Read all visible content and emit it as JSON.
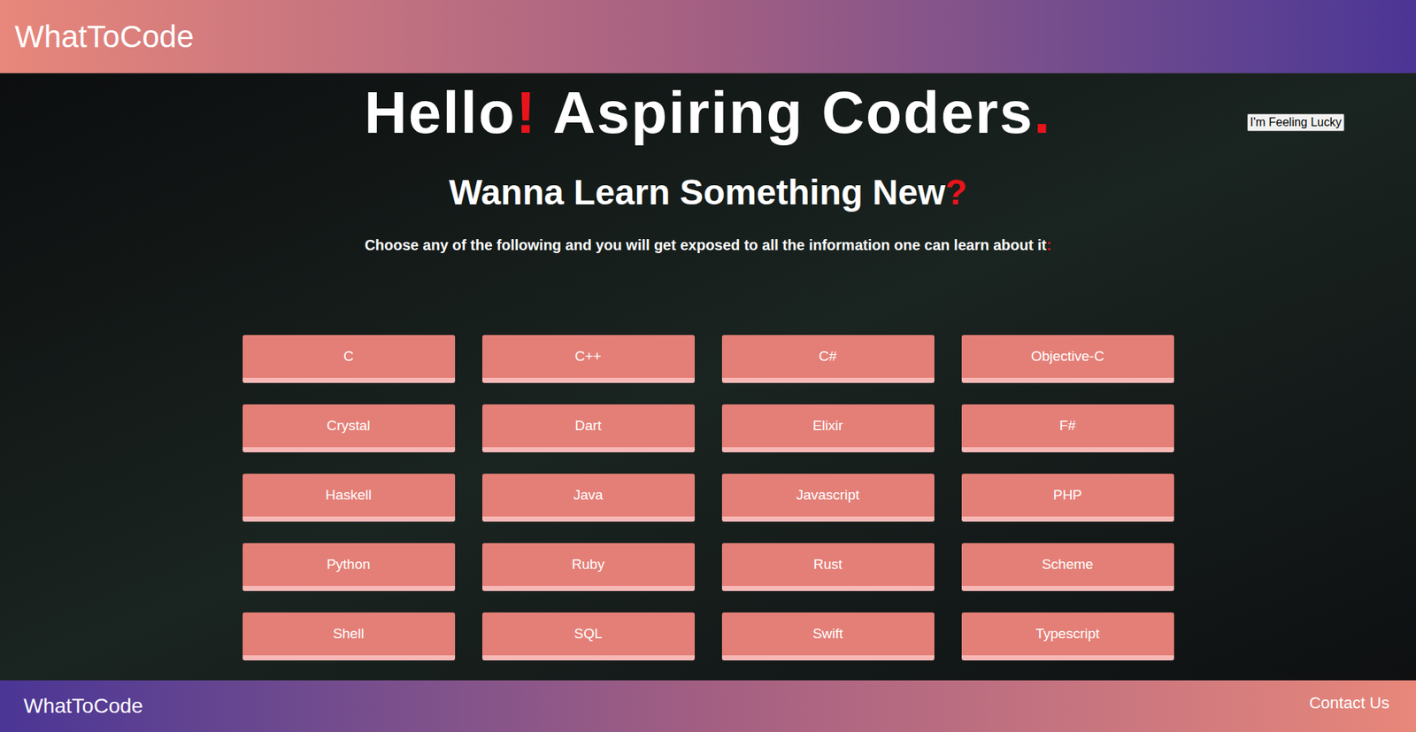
{
  "header": {
    "brand": "WhatToCode"
  },
  "heading": [
    {
      "text": "Hello",
      "accent": false
    },
    {
      "text": "!",
      "accent": true
    },
    {
      "text": " Aspiring Coders",
      "accent": false
    },
    {
      "text": ".",
      "accent": true
    }
  ],
  "subheading": [
    {
      "text": "Wanna Learn Something New",
      "accent": false
    },
    {
      "text": "?",
      "accent": true
    }
  ],
  "intro": [
    {
      "text": "Choose any of the following and you will get exposed to all the information one can learn about it",
      "accent": false
    },
    {
      "text": ":",
      "accent": true
    }
  ],
  "lucky_button": "I'm Feeling Lucky",
  "languages": [
    "C",
    "C++",
    "C#",
    "Objective-C",
    "Crystal",
    "Dart",
    "Elixir",
    "F#",
    "Haskell",
    "Java",
    "Javascript",
    "PHP",
    "Python",
    "Ruby",
    "Rust",
    "Scheme",
    "Shell",
    "SQL",
    "Swift",
    "Typescript"
  ],
  "footer": {
    "brand": "WhatToCode",
    "contact": "Contact Us"
  }
}
